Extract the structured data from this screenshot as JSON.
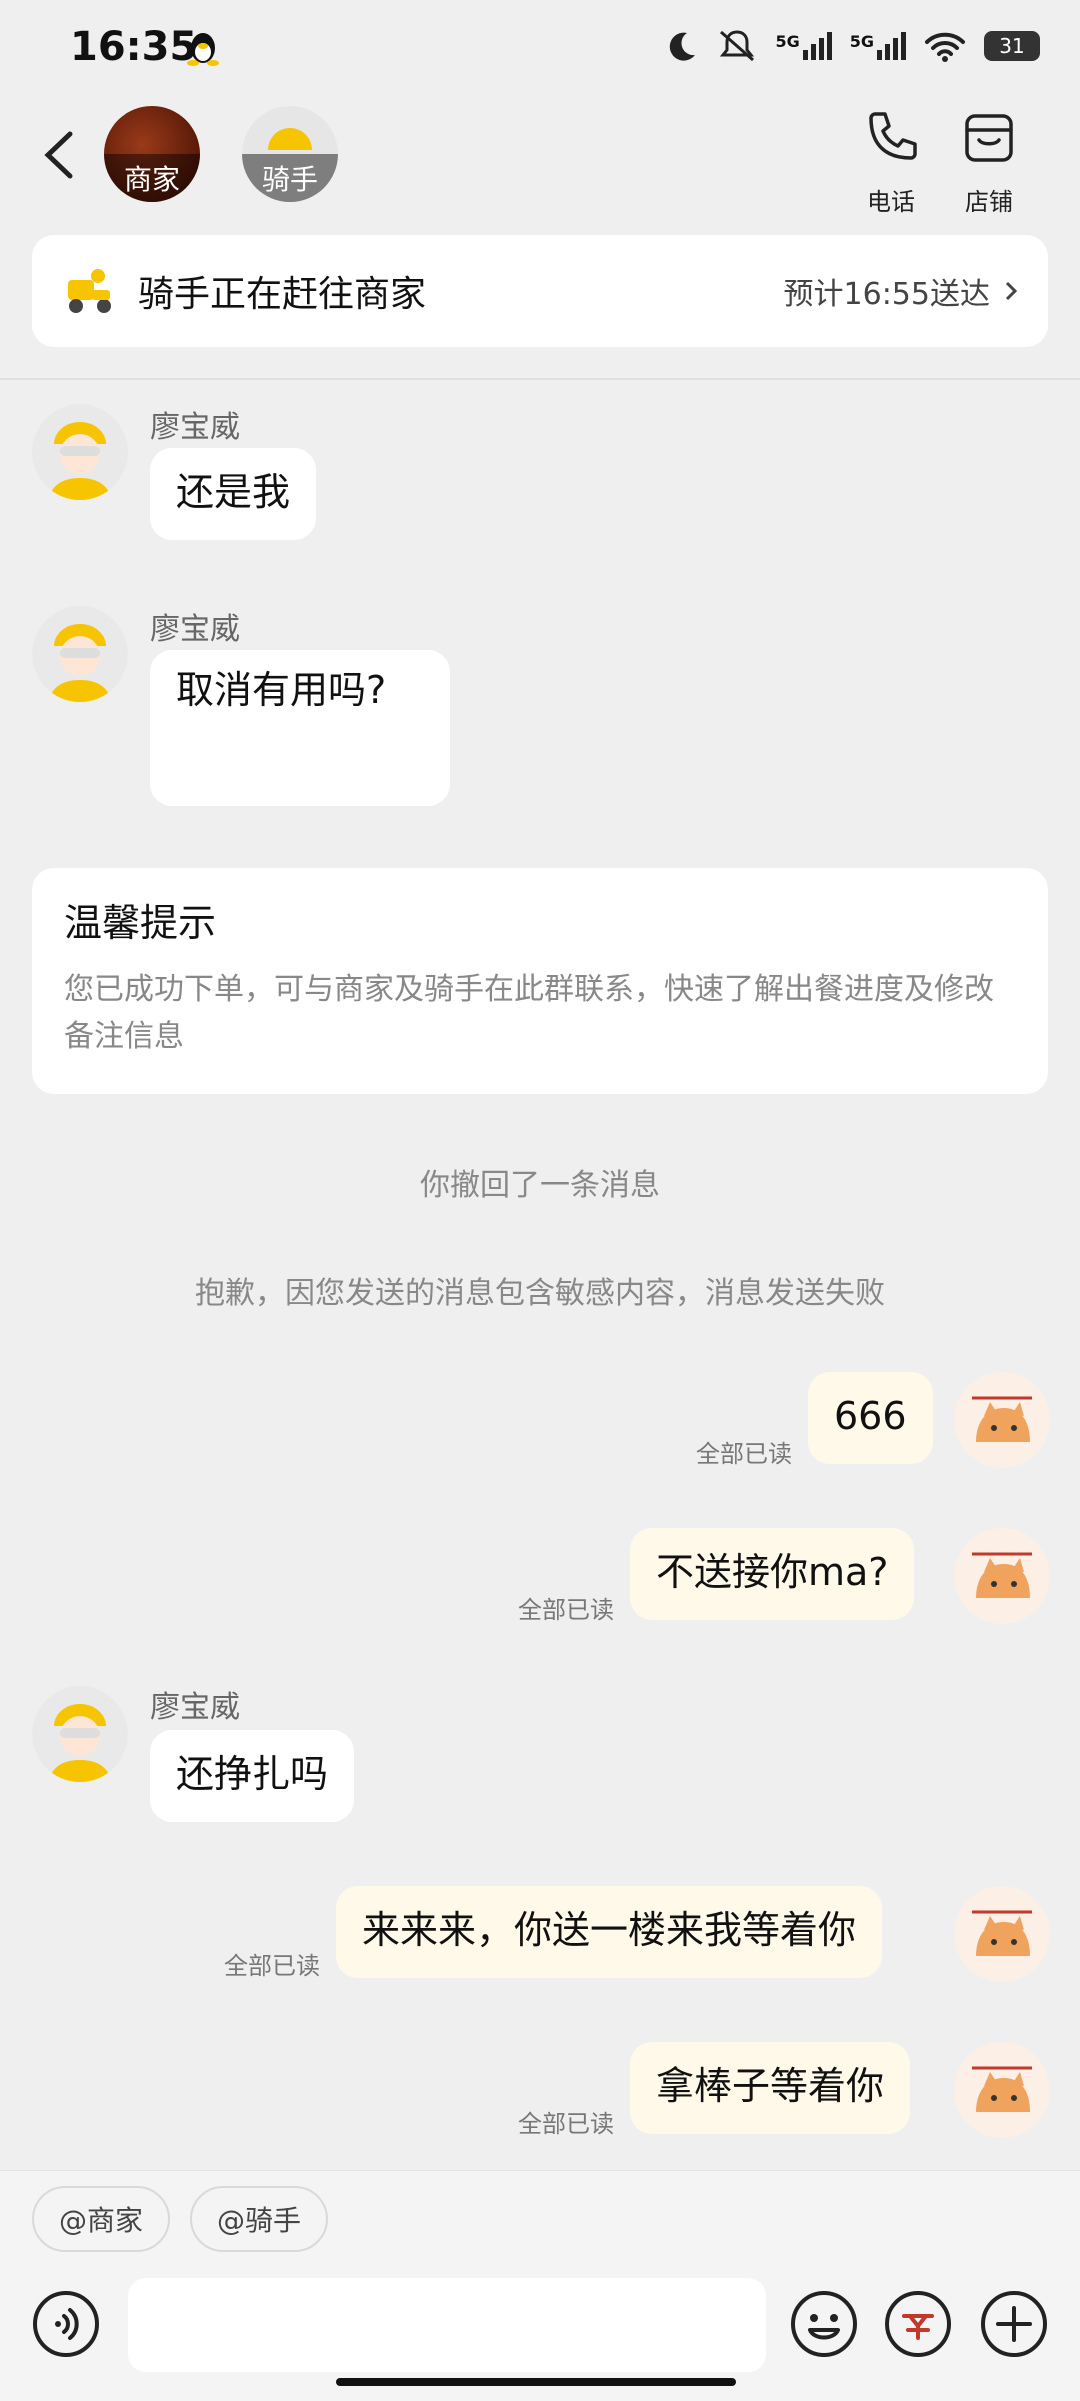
{
  "status_bar": {
    "time": "16:35",
    "battery": "31",
    "net1": "5G",
    "net2": "5G"
  },
  "header": {
    "merchant_label": "商家",
    "rider_label": "骑手",
    "phone_label": "电话",
    "shop_label": "店铺"
  },
  "delivery": {
    "status": "骑手正在赶往商家",
    "eta": "预计16:55送达"
  },
  "messages": [
    {
      "sender": "廖宝威",
      "text": "还是我"
    },
    {
      "sender": "廖宝威",
      "text": "取消有用吗?"
    },
    {
      "sender": "廖宝威",
      "text": "还挣扎吗"
    }
  ],
  "tip": {
    "title": "温馨提示",
    "body": "您已成功下单，可与商家及骑手在此群联系，快速了解出餐进度及修改备注信息"
  },
  "system": {
    "recalled": "你撤回了一条消息",
    "failed": "抱歉，因您发送的消息包含敏感内容，消息发送失败"
  },
  "my_messages": [
    {
      "text": "666",
      "status": "全部已读"
    },
    {
      "text": "不送接你ma?",
      "status": "全部已读"
    },
    {
      "text": "来来来，你送一楼来我等着你",
      "status": "全部已读"
    },
    {
      "text": "拿棒子等着你",
      "status": "全部已读"
    }
  ],
  "mentions": [
    "@商家",
    "@骑手"
  ],
  "colors": {
    "accent": "#f6c400",
    "bubble_me": "#fff9ea"
  }
}
